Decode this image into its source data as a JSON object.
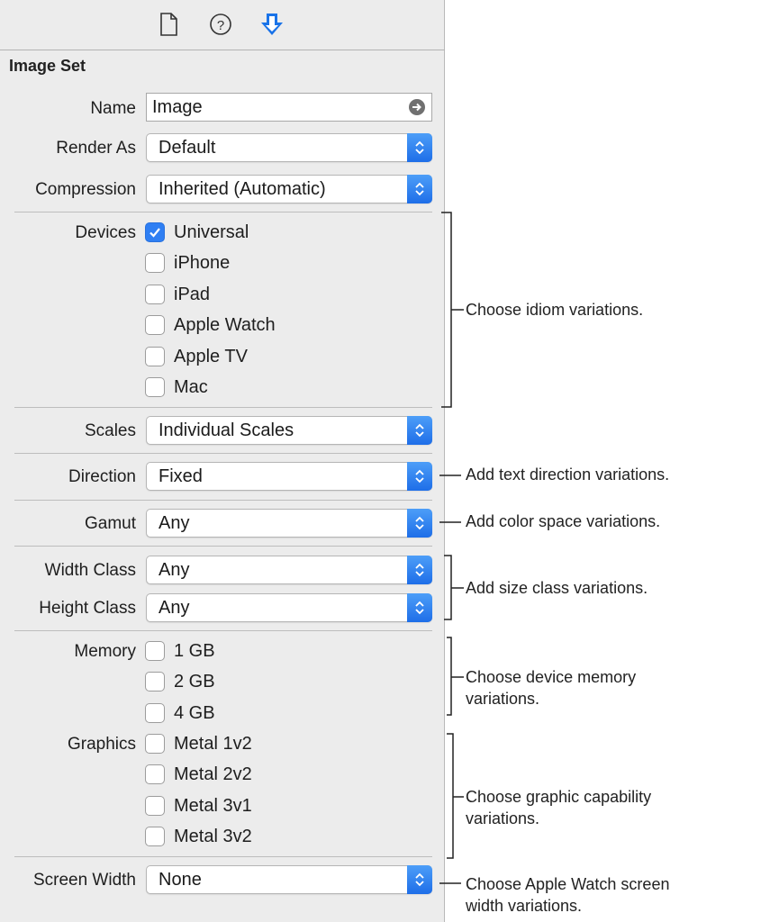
{
  "toolbar": {
    "icons": [
      "file-inspector-icon",
      "quick-help-icon",
      "attributes-inspector-icon"
    ],
    "active_color": "#1a73e8"
  },
  "section": {
    "title": "Image Set"
  },
  "fields": {
    "name": {
      "label": "Name",
      "value": "Image"
    },
    "render_as": {
      "label": "Render As",
      "value": "Default"
    },
    "compression": {
      "label": "Compression",
      "value": "Inherited (Automatic)"
    },
    "scales": {
      "label": "Scales",
      "value": "Individual Scales"
    },
    "direction": {
      "label": "Direction",
      "value": "Fixed"
    },
    "gamut": {
      "label": "Gamut",
      "value": "Any"
    },
    "width_class": {
      "label": "Width Class",
      "value": "Any"
    },
    "height_class": {
      "label": "Height Class",
      "value": "Any"
    },
    "screen_width": {
      "label": "Screen Width",
      "value": "None"
    }
  },
  "devices": {
    "label": "Devices",
    "items": [
      {
        "label": "Universal",
        "checked": true
      },
      {
        "label": "iPhone",
        "checked": false
      },
      {
        "label": "iPad",
        "checked": false
      },
      {
        "label": "Apple Watch",
        "checked": false
      },
      {
        "label": "Apple TV",
        "checked": false
      },
      {
        "label": "Mac",
        "checked": false
      }
    ]
  },
  "memory": {
    "label": "Memory",
    "items": [
      {
        "label": "1 GB",
        "checked": false
      },
      {
        "label": "2 GB",
        "checked": false
      },
      {
        "label": "4 GB",
        "checked": false
      }
    ]
  },
  "graphics": {
    "label": "Graphics",
    "items": [
      {
        "label": "Metal 1v2",
        "checked": false
      },
      {
        "label": "Metal 2v2",
        "checked": false
      },
      {
        "label": "Metal 3v1",
        "checked": false
      },
      {
        "label": "Metal 3v2",
        "checked": false
      }
    ]
  },
  "annotations": {
    "idiom": "Choose idiom variations.",
    "direction": "Add text direction variations.",
    "gamut": "Add color space variations.",
    "size_class": "Add size class variations.",
    "memory_1": "Choose device memory",
    "memory_2": "variations.",
    "graphics_1": "Choose graphic capability",
    "graphics_2": "variations.",
    "screen_1": "Choose Apple Watch screen",
    "screen_2": "width variations."
  },
  "colors": {
    "accent": "#2f7ff3",
    "panel_bg": "#ececec"
  }
}
